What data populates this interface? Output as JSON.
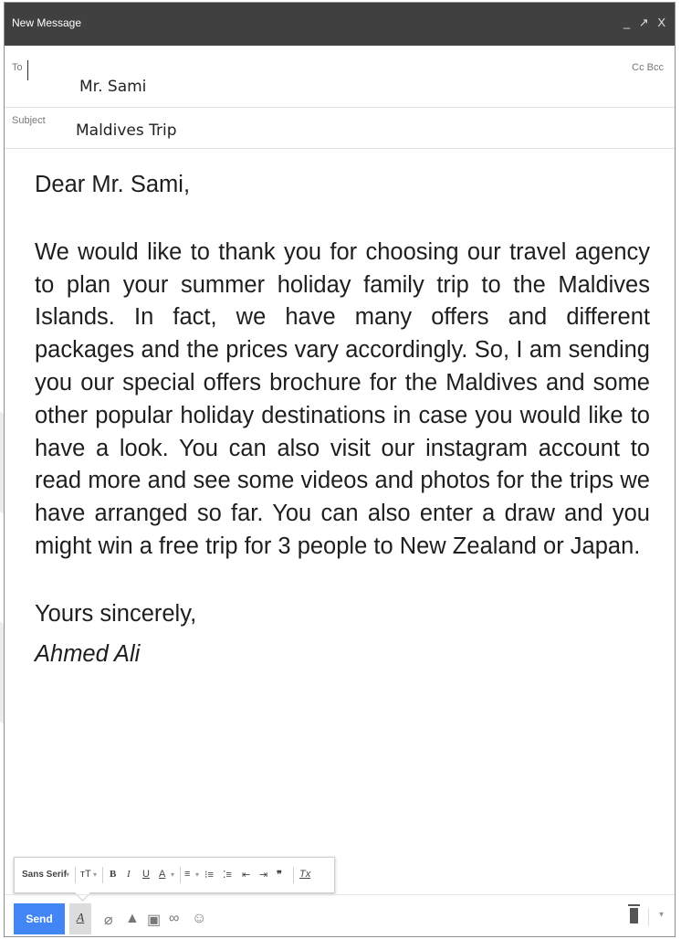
{
  "window": {
    "title": "New Message",
    "minimize": "_",
    "popout": "↗",
    "close": "X"
  },
  "to": {
    "label": "To",
    "value": "Mr. Sami",
    "cc": "Cc",
    "bcc": "Bcc"
  },
  "subject": {
    "label": "Subject",
    "value": "Maldives Trip"
  },
  "message": {
    "greeting": "Dear Mr. Sami,",
    "body": "We would like to thank you for choosing our travel agency to plan your summer holiday family trip to the Maldives Islands. In fact, we have many offers and different packages and the prices vary accordingly. So, I am sending you our special offers brochure for the Maldives and some other popular holiday destinations in case you would like to have a look. You can also visit our instagram account to read more and see some videos and photos for the trips we have arranged so far. You can also enter a draw and you might win a free trip for 3 people to New Zealand or Japan.",
    "closing": "Yours sincerely,",
    "signature": "Ahmed Ali"
  },
  "format_toolbar": {
    "font": "Sans Serif",
    "dropdown_caret": "▾",
    "size": "тT",
    "bold": "B",
    "italic": "I",
    "underline": "U",
    "text_color": "A",
    "align": "≡",
    "numbered_list": "⁝≡",
    "bulleted_list": "⁚≡",
    "indent_less": "⇤",
    "indent_more": "⇥",
    "quote": "❞",
    "remove_format": "Tx"
  },
  "bottom_toolbar": {
    "send": "Send",
    "format_toggle": "A",
    "attach": "⌀",
    "drive": "▲",
    "photo": "▣",
    "link": "∞",
    "emoji": "☺",
    "more_options": "▾"
  }
}
